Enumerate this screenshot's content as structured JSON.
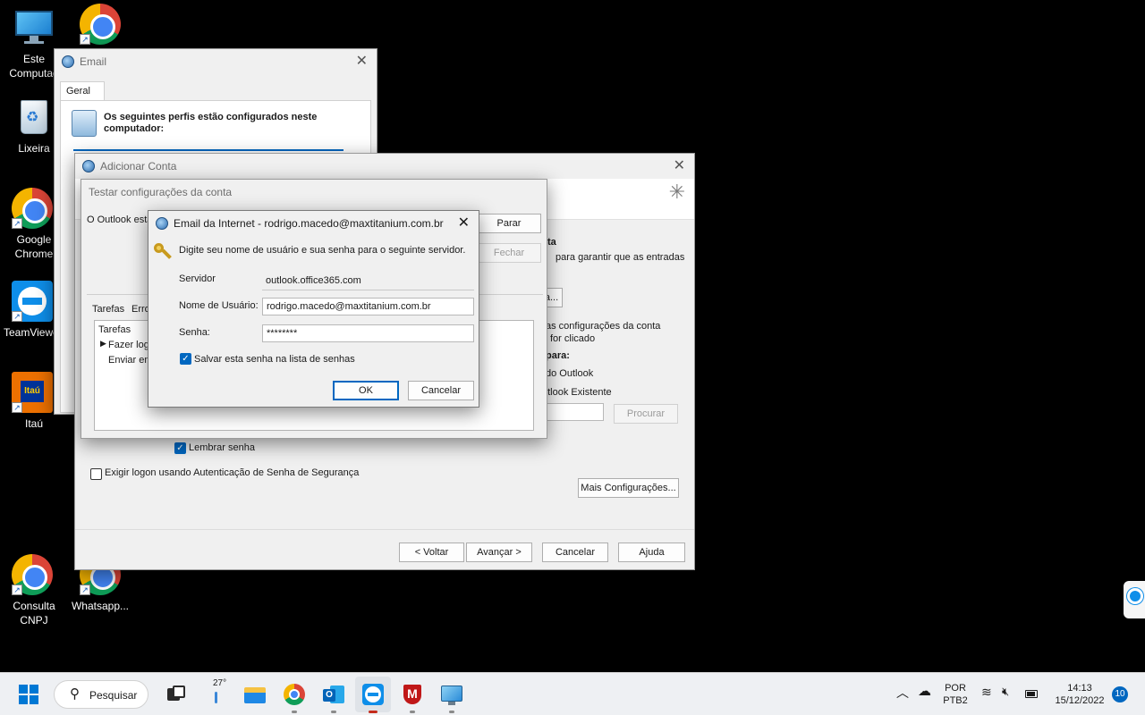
{
  "desktop": {
    "icons": [
      {
        "label": "Este Computad"
      },
      {
        "label": "Lixeira"
      },
      {
        "label": "Google Chrome"
      },
      {
        "label": "TeamViewer"
      },
      {
        "label": "Itaú"
      },
      {
        "label": "Consulta CNPJ"
      },
      {
        "label": "Whatsapp..."
      }
    ]
  },
  "email_window": {
    "title": "Email",
    "tab": "Geral",
    "description": "Os seguintes perfis estão configurados neste computador:"
  },
  "add_account_window": {
    "title": "Adicionar Conta",
    "right_heading": "ta",
    "right_line1": "para garantir que as entradas",
    "right_line2": "as configurações da conta",
    "right_line3": "for clicado",
    "right_heading2": "para:",
    "right_option1": "do Outlook",
    "right_option2": "utlook Existente",
    "browse_button": "Procurar",
    "remember_password": "Lembrar senha",
    "require_spa": "Exigir logon usando Autenticação de Senha de Segurança",
    "more_settings": "Mais Configurações...",
    "back": "< Voltar",
    "next": "Avançar >",
    "cancel": "Cancelar",
    "help": "Ajuda"
  },
  "test_window": {
    "title": "Testar configurações da conta",
    "status": "O Outlook está",
    "stop": "Parar",
    "close": "Fechar",
    "tab_tasks": "Tarefas",
    "tab_errors": "Erros",
    "col_tasks": "Tarefas",
    "task1": "Fazer logo",
    "task2": "Enviar em"
  },
  "login_dialog": {
    "title": "Email da Internet - rodrigo.macedo@maxtitanium.com.br",
    "prompt": "Digite seu nome de usuário e sua senha para o seguinte servidor.",
    "server_label": "Servidor",
    "server_value": "outlook.office365.com",
    "username_label": "Nome de Usuário:",
    "username_value": "rodrigo.macedo@maxtitanium.com.br",
    "password_label": "Senha:",
    "password_value": "********",
    "save_password": "Salvar esta senha na lista de senhas",
    "ok": "OK",
    "cancel": "Cancelar"
  },
  "taskbar": {
    "search": "Pesquisar",
    "weather": "27°",
    "lang1": "POR",
    "lang2": "PTB2",
    "time": "14:13",
    "date": "15/12/2022",
    "notifications": "10"
  }
}
